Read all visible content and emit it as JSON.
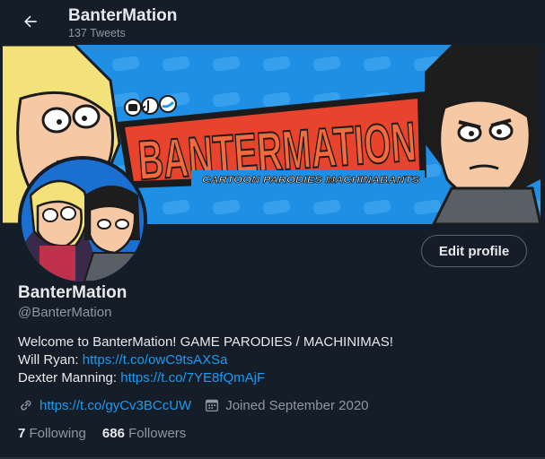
{
  "header": {
    "title": "BanterMation",
    "tweet_count": "137 Tweets"
  },
  "banner": {
    "title_text": "BANTERMATION",
    "tagline": "CARTOON PARODIES  MACHINABANTS",
    "social_icons": [
      "youtube-icon",
      "tiktok-icon",
      "twitter-icon"
    ]
  },
  "profile": {
    "edit_label": "Edit profile",
    "display_name": "BanterMation",
    "handle": "@BanterMation",
    "bio": {
      "line1": "Welcome to BanterMation! GAME PARODIES / MACHINIMAS!",
      "line2_label": "Will Ryan: ",
      "line2_link": "https://t.co/owC9tsAXSa",
      "line3_label": "Dexter Manning: ",
      "line3_link": "https://t.co/7YE8fQmAjF"
    },
    "website": "https://t.co/gyCv3BCcUW",
    "joined": "Joined September 2020",
    "following_count": "7",
    "following_label": "Following",
    "followers_count": "686",
    "followers_label": "Followers"
  },
  "colors": {
    "background": "#151d28",
    "accent": "#1d9bf0",
    "banner_blue": "#1e90e6",
    "banner_title_red": "#e8432c"
  }
}
